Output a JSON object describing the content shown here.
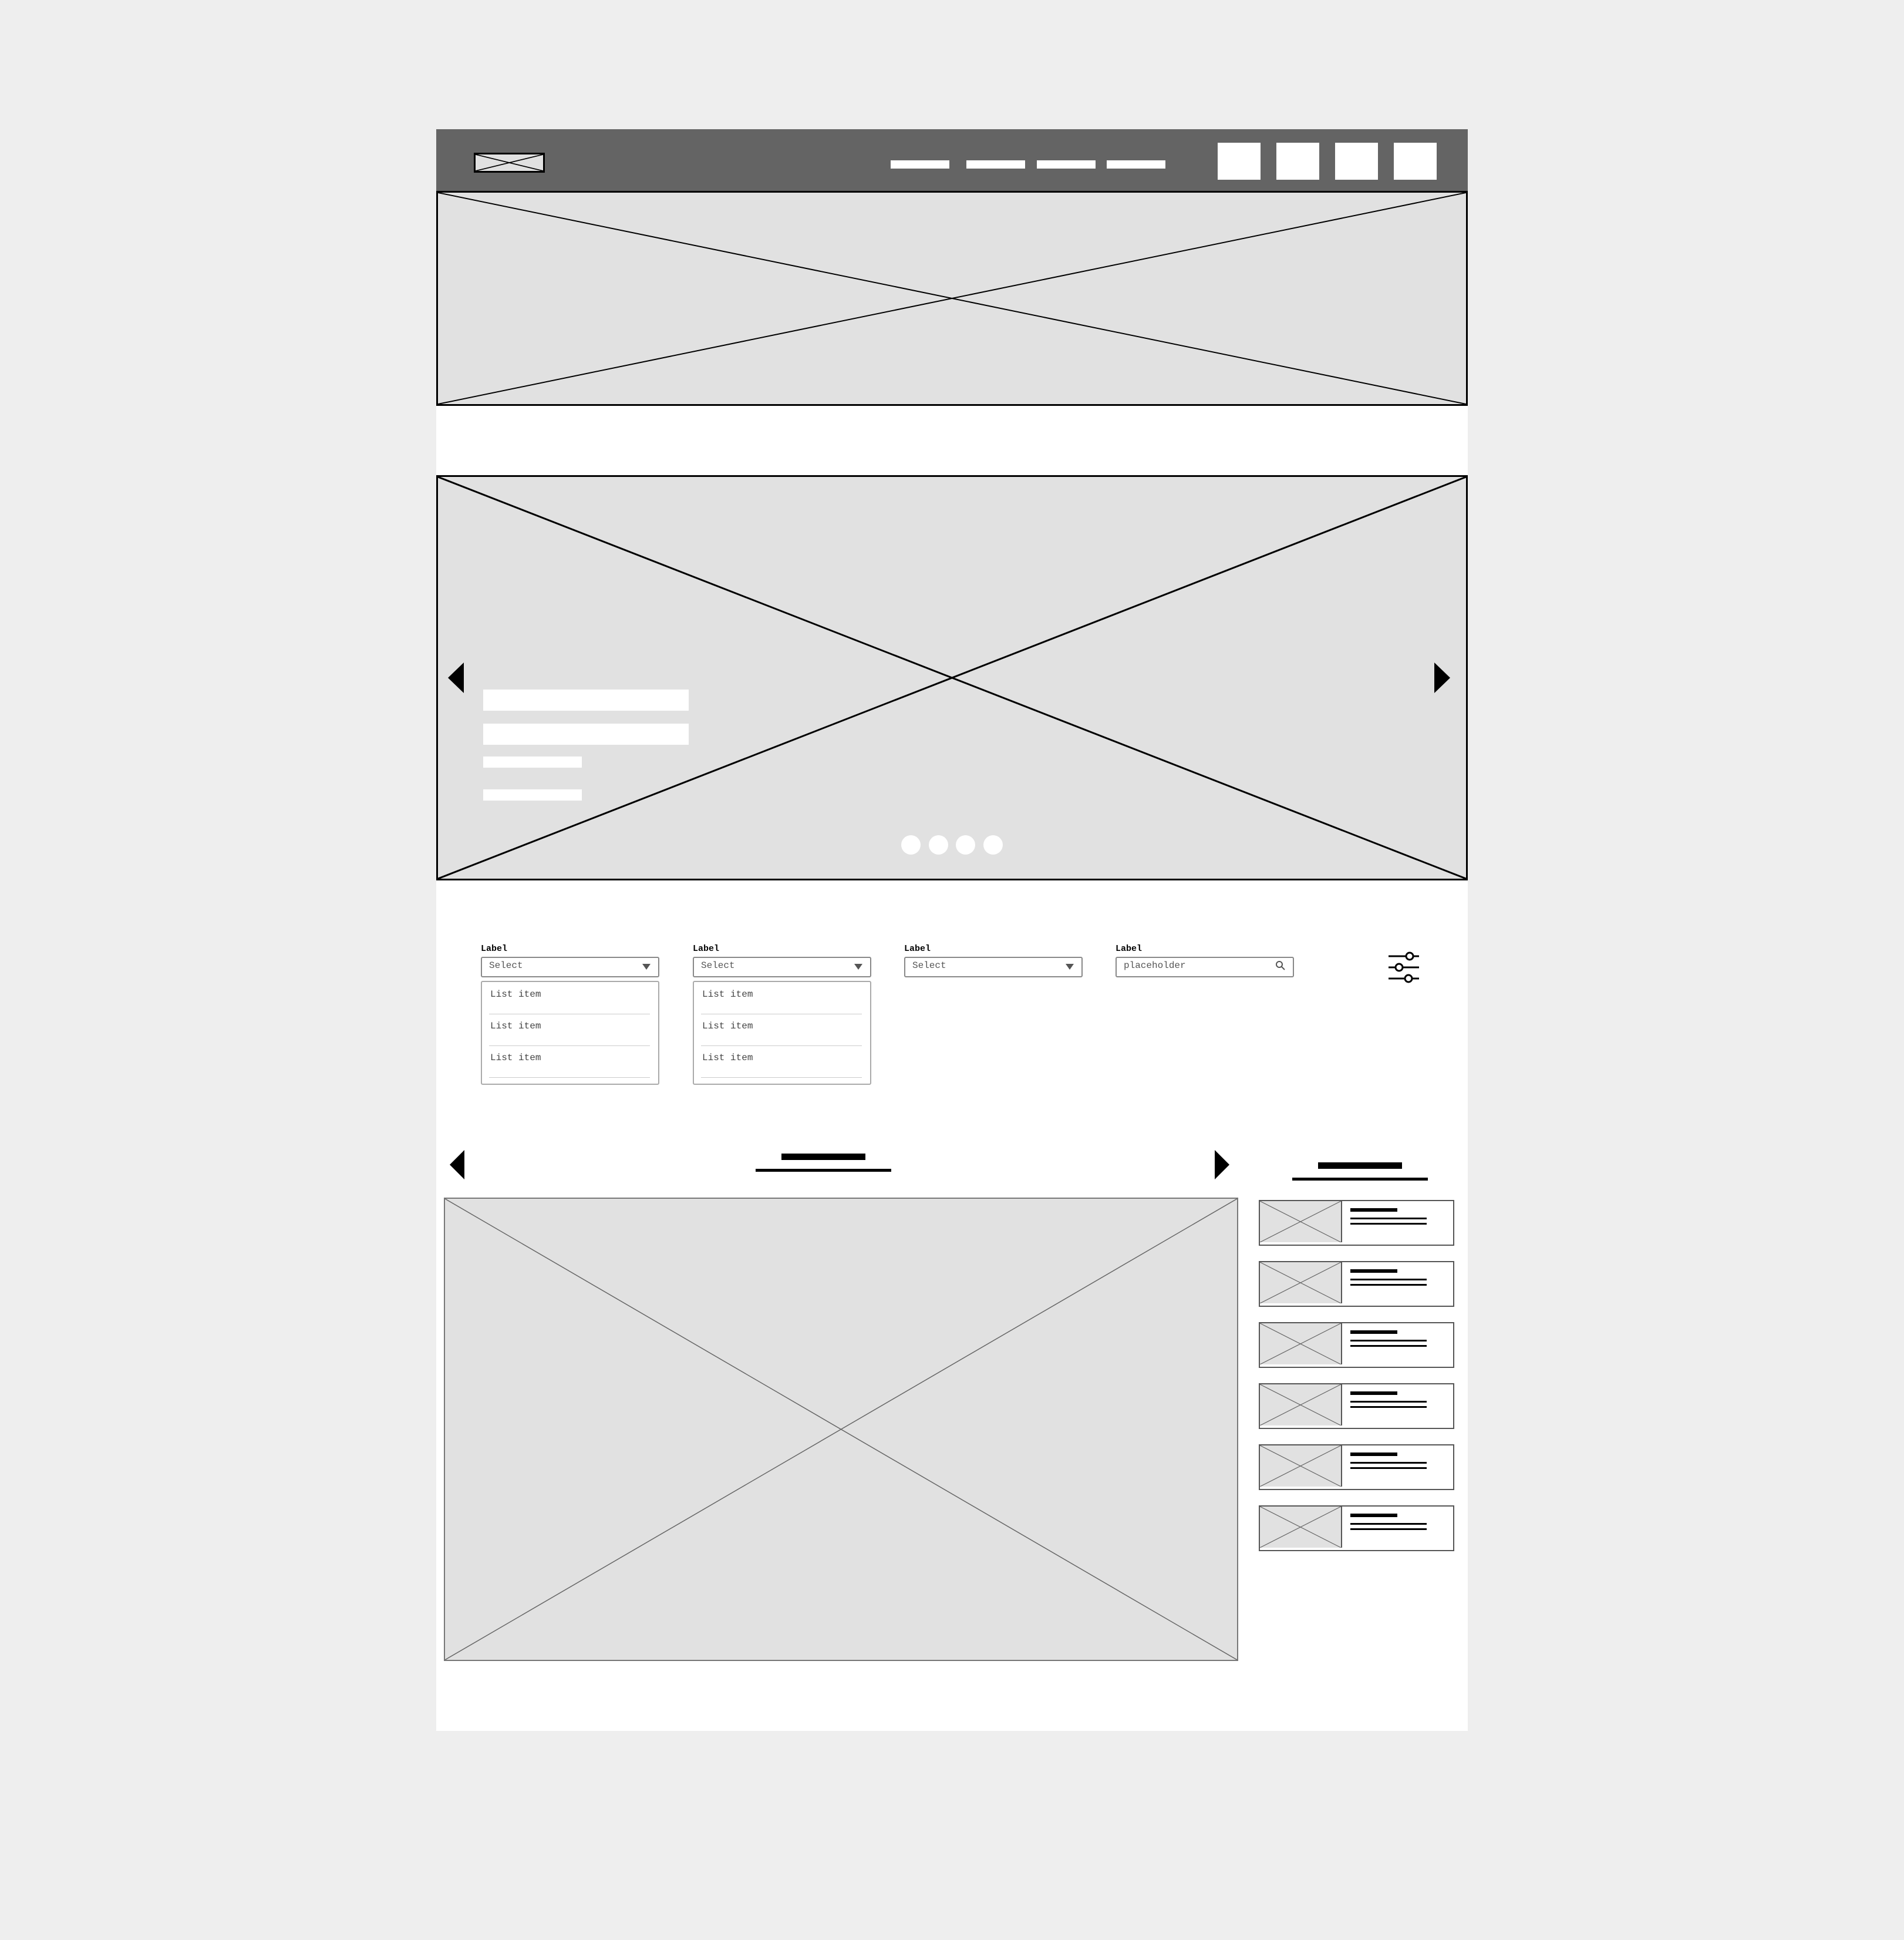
{
  "header": {
    "logo_icon": "image-placeholder-icon",
    "nav_links": [
      "",
      "",
      "",
      ""
    ],
    "icon_buttons": [
      "",
      "",
      "",
      ""
    ],
    "background": "#646464"
  },
  "banner": {
    "icon": "image-placeholder-icon"
  },
  "carousel": {
    "prev_icon": "triangle-left-icon",
    "next_icon": "triangle-right-icon",
    "dots": 4
  },
  "filters": {
    "fields": [
      {
        "label": "Label",
        "value": "Select",
        "open": true,
        "items": [
          "List item",
          "List item",
          "List item"
        ]
      },
      {
        "label": "Label",
        "value": "Select",
        "open": true,
        "items": [
          "List item",
          "List item",
          "List item"
        ]
      },
      {
        "label": "Label",
        "value": "Select",
        "open": false
      },
      {
        "label": "Label",
        "placeholder": "placeholder",
        "type": "search"
      }
    ],
    "settings_icon": "sliders-icon"
  },
  "gallery": {
    "prev_icon": "triangle-left-icon",
    "next_icon": "triangle-right-icon"
  },
  "side_list": {
    "count": 6
  }
}
